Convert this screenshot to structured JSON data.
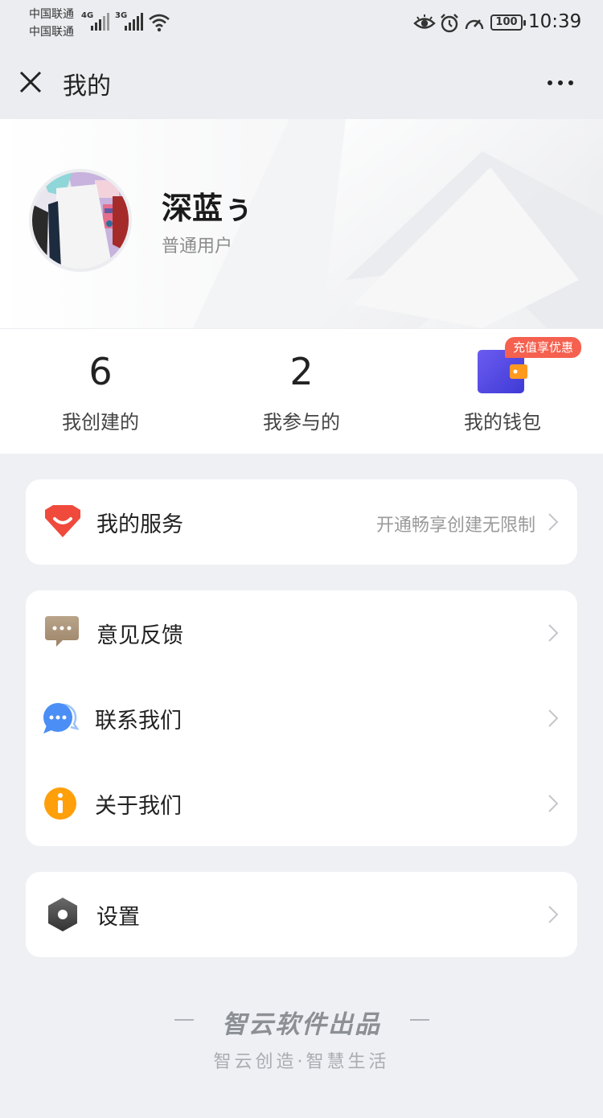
{
  "status_bar": {
    "carrier1": "中国联通",
    "carrier2": "中国联通",
    "net1": "4G",
    "net2": "3G",
    "battery": "100",
    "time": "10:39"
  },
  "nav": {
    "title": "我的"
  },
  "profile": {
    "username": "深蓝ぅ",
    "user_type": "普通用户"
  },
  "stats": [
    {
      "value": "6",
      "label": "我创建的"
    },
    {
      "value": "2",
      "label": "我参与的"
    },
    {
      "label": "我的钱包",
      "badge": "充值享优惠"
    }
  ],
  "service": {
    "label": "我的服务",
    "hint": "开通畅享创建无限制"
  },
  "menu": [
    {
      "label": "意见反馈",
      "icon": "feedback-icon"
    },
    {
      "label": "联系我们",
      "icon": "contact-icon"
    },
    {
      "label": "关于我们",
      "icon": "info-icon"
    }
  ],
  "settings": {
    "label": "设置",
    "icon": "settings-icon"
  },
  "footer": {
    "title": "智云软件出品",
    "slogan": "智云创造·智慧生活"
  },
  "colors": {
    "page_bg": "#eef0f3",
    "badge": "#f5604f",
    "wallet": "#5b4ee6",
    "service_icon": "#ef4a3c",
    "info_icon": "#ff9f0a",
    "contact_icon": "#4b8ef5"
  }
}
